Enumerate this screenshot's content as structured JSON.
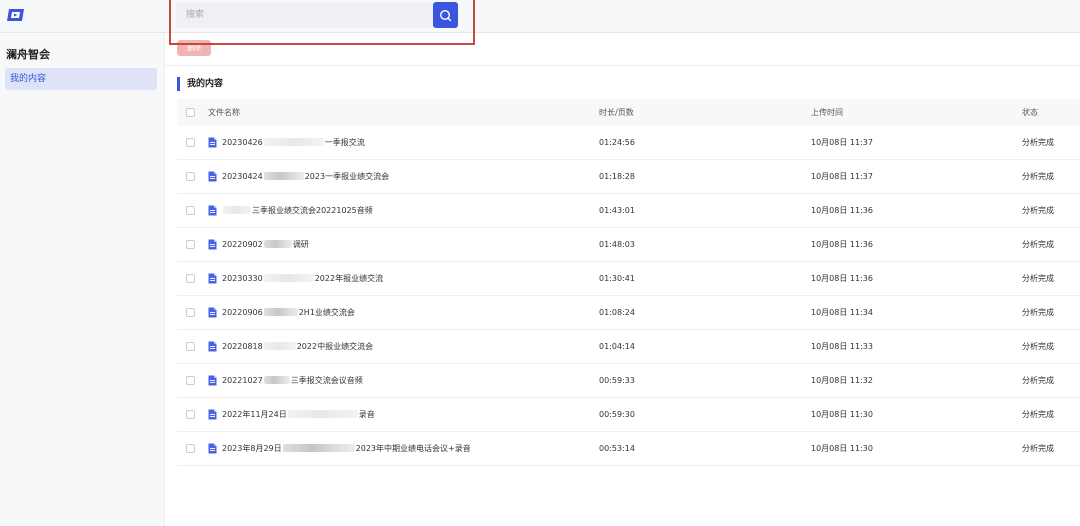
{
  "app": {
    "brand": "澜舟智会"
  },
  "search": {
    "placeholder": "搜索"
  },
  "sidebar": {
    "items": [
      {
        "label": "我的内容"
      }
    ]
  },
  "toolbar": {
    "delete_label": "删除"
  },
  "section": {
    "title": "我的内容"
  },
  "table": {
    "headers": {
      "name": "文件名称",
      "duration": "时长/页数",
      "upload_time": "上传时间",
      "status": "状态"
    },
    "rows": [
      {
        "name_prefix": "20230426",
        "name_suffix": "一季报交流",
        "duration": "01:24:56",
        "upload_time": "10月08日 11:37",
        "status": "分析完成"
      },
      {
        "name_prefix": "20230424",
        "name_suffix": "2023一季报业绩交流会",
        "duration": "01:18:28",
        "upload_time": "10月08日 11:37",
        "status": "分析完成"
      },
      {
        "name_prefix": "",
        "name_suffix": "三季报业绩交流会20221025音频",
        "duration": "01:43:01",
        "upload_time": "10月08日 11:36",
        "status": "分析完成"
      },
      {
        "name_prefix": "20220902",
        "name_suffix": "调研",
        "duration": "01:48:03",
        "upload_time": "10月08日 11:36",
        "status": "分析完成"
      },
      {
        "name_prefix": "20230330",
        "name_suffix": "2022年报业绩交流",
        "duration": "01:30:41",
        "upload_time": "10月08日 11:36",
        "status": "分析完成"
      },
      {
        "name_prefix": "20220906",
        "name_suffix": "2H1业绩交流会",
        "duration": "01:08:24",
        "upload_time": "10月08日 11:34",
        "status": "分析完成"
      },
      {
        "name_prefix": "20220818",
        "name_suffix": "2022中报业绩交流会",
        "duration": "01:04:14",
        "upload_time": "10月08日 11:33",
        "status": "分析完成"
      },
      {
        "name_prefix": "20221027",
        "name_suffix": "三季报交流会议音频",
        "duration": "00:59:33",
        "upload_time": "10月08日 11:32",
        "status": "分析完成"
      },
      {
        "name_prefix": "2022年11月24日",
        "name_suffix": "录音",
        "duration": "00:59:30",
        "upload_time": "10月08日 11:30",
        "status": "分析完成"
      },
      {
        "name_prefix": "2023年8月29日",
        "name_suffix": "2023年中期业绩电话会议+录音",
        "duration": "00:53:14",
        "upload_time": "10月08日 11:30",
        "status": "分析完成"
      }
    ]
  },
  "colors": {
    "accent": "#3a56e0",
    "highlight_box": "#c9473f",
    "delete_button": "#f2b3b3",
    "nav_active_bg": "#dfe3f8"
  },
  "icons": {
    "logo": "app-logo-icon",
    "search": "search-icon",
    "file": "document-icon"
  }
}
